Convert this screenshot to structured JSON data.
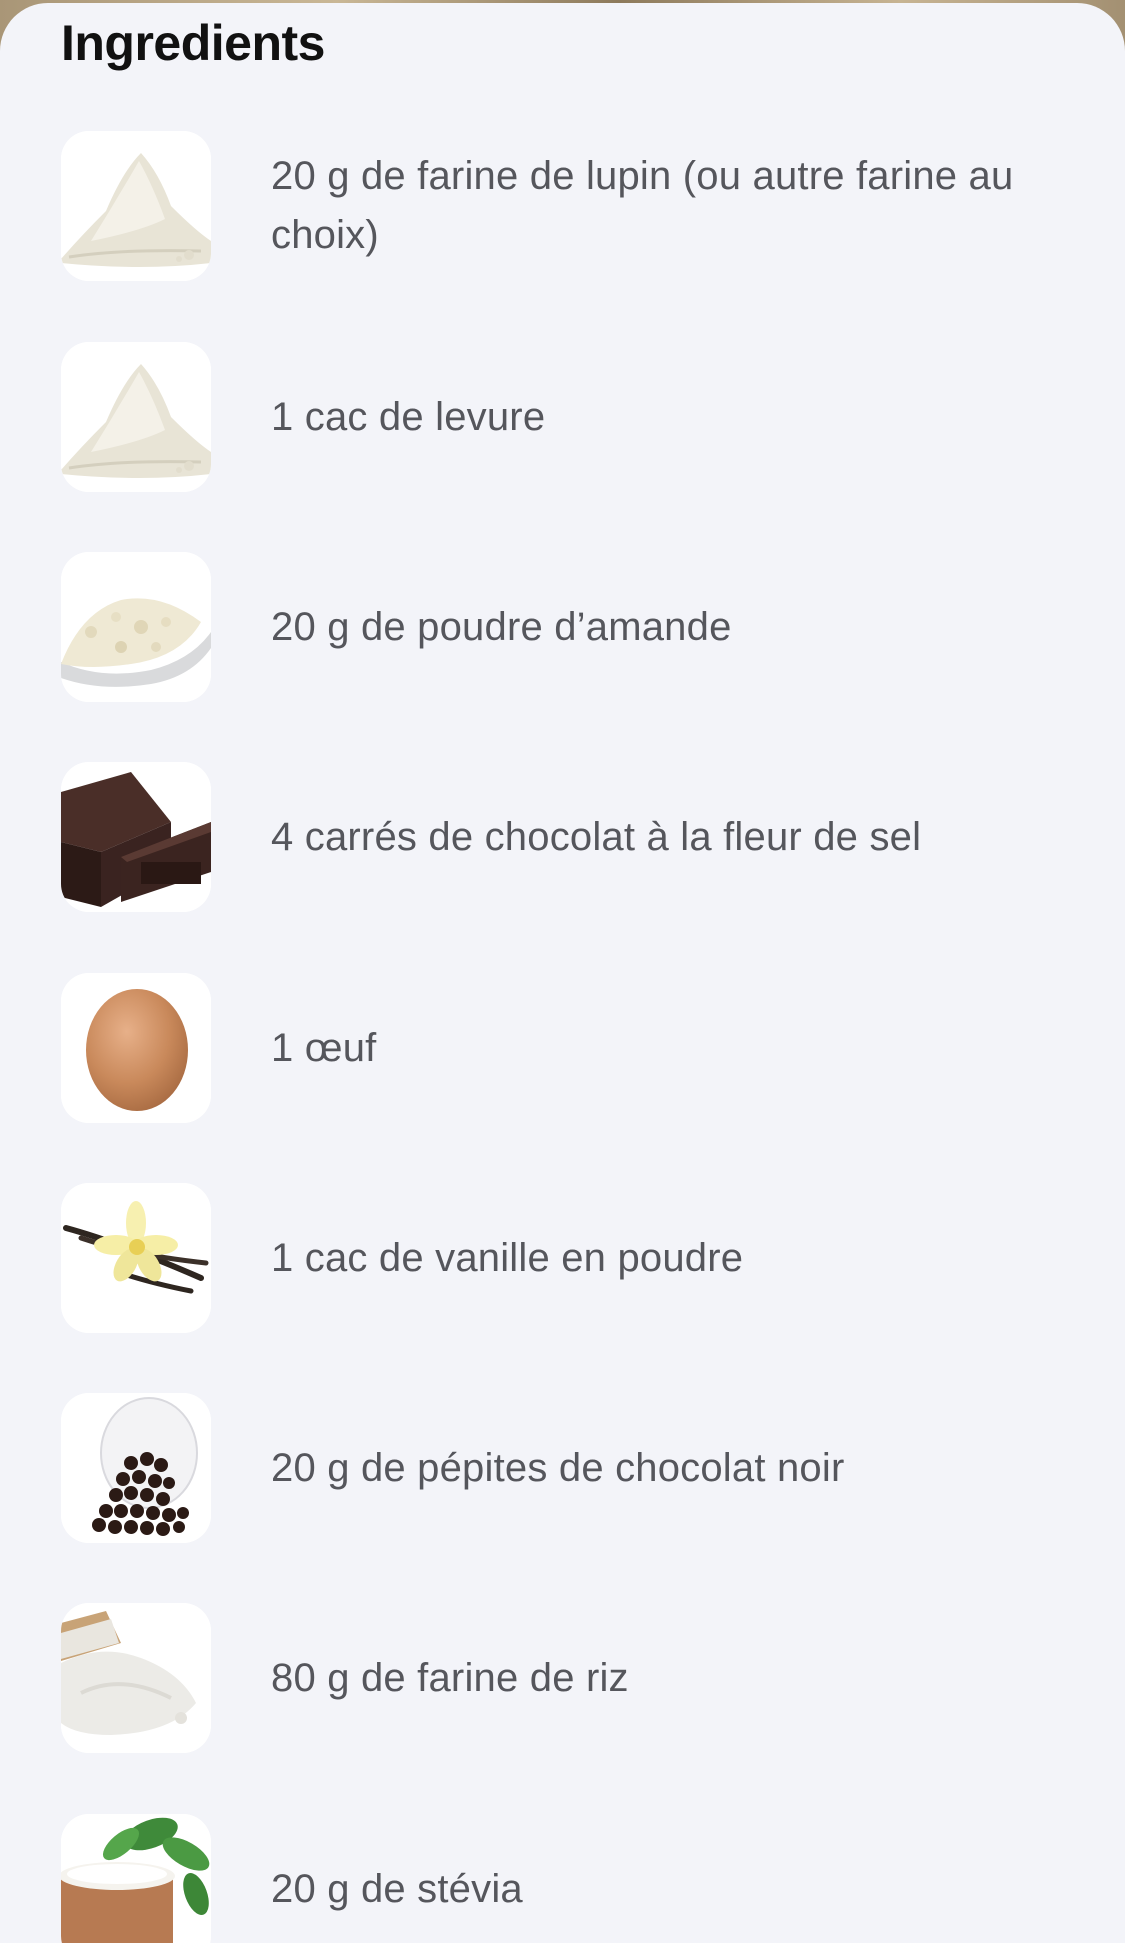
{
  "section": {
    "title": "Ingredients"
  },
  "ingredients": [
    {
      "label": "20 g de farine de lupin (ou autre farine au choix)",
      "icon": "flour-icon"
    },
    {
      "label": "1 cac de levure",
      "icon": "flour-icon"
    },
    {
      "label": "20 g de poudre d’amande",
      "icon": "almond-powder-icon"
    },
    {
      "label": "4 carrés de chocolat à la fleur de sel",
      "icon": "chocolate-bar-icon"
    },
    {
      "label": "1 œuf",
      "icon": "egg-icon"
    },
    {
      "label": "1 cac de vanille en poudre",
      "icon": "vanilla-icon"
    },
    {
      "label": "20 g de pépites de chocolat noir",
      "icon": "chocolate-chips-icon"
    },
    {
      "label": "80 g de farine de riz",
      "icon": "rice-flour-icon"
    },
    {
      "label": "20 g de stévia",
      "icon": "stevia-icon"
    }
  ],
  "colors": {
    "sheet_background": "#f3f4f9",
    "title_text": "#111111",
    "item_text": "#55565c",
    "thumb_background": "#ffffff"
  }
}
